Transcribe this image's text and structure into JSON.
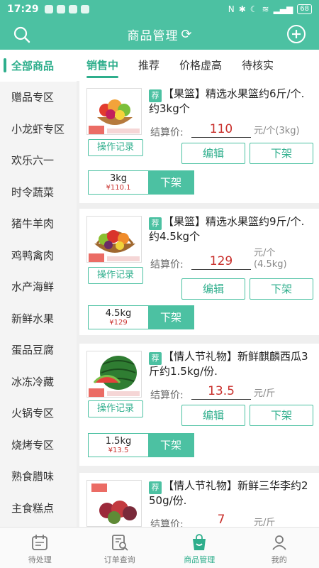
{
  "status_bar": {
    "time": "17:29",
    "battery": "68"
  },
  "header": {
    "title": "商品管理",
    "refresh_icon": "refresh-icon",
    "search_icon": "search-icon",
    "add_icon": "plus-circle-icon"
  },
  "sidebar": {
    "items": [
      {
        "label": "全部商品",
        "active": true
      },
      {
        "label": "赠品专区"
      },
      {
        "label": "小龙虾专区"
      },
      {
        "label": "欢乐六一"
      },
      {
        "label": "时令蔬菜"
      },
      {
        "label": "猪牛羊肉"
      },
      {
        "label": "鸡鸭禽肉"
      },
      {
        "label": "水产海鲜"
      },
      {
        "label": "新鲜水果"
      },
      {
        "label": "蛋品豆腐"
      },
      {
        "label": "冰冻冷藏"
      },
      {
        "label": "火锅专区"
      },
      {
        "label": "烧烤专区"
      },
      {
        "label": "熟食腊味"
      },
      {
        "label": "主食糕点"
      }
    ]
  },
  "tabs": [
    {
      "label": "销售中",
      "active": true
    },
    {
      "label": "推荐"
    },
    {
      "label": "价格虚高"
    },
    {
      "label": "待核实"
    }
  ],
  "products": [
    {
      "badge": "荐",
      "name": "【果篮】精选水果篮约6斤/个.约3kg个",
      "price_label": "结算价:",
      "price": "110",
      "unit": "元/个(3kg)",
      "op_label": "操作记录",
      "edit_label": "编辑",
      "off_label": "下架",
      "spec": {
        "weight": "3kg",
        "price": "¥110.1",
        "off_label": "下架"
      }
    },
    {
      "badge": "荐",
      "name": "【果篮】精选水果篮约9斤/个.约4.5kg个",
      "price_label": "结算价:",
      "price": "129",
      "unit": "元/个\n(4.5kg)",
      "op_label": "操作记录",
      "edit_label": "编辑",
      "off_label": "下架",
      "spec": {
        "weight": "4.5kg",
        "price": "¥129",
        "off_label": "下架"
      }
    },
    {
      "badge": "荐",
      "name": "【情人节礼物】新鲜麒麟西瓜3斤约1.5kg/份.",
      "price_label": "结算价:",
      "price": "13.5",
      "unit": "元/斤",
      "op_label": "操作记录",
      "edit_label": "编辑",
      "off_label": "下架",
      "spec": {
        "weight": "1.5kg",
        "price": "¥13.5",
        "off_label": "下架"
      }
    },
    {
      "badge": "荐",
      "name": "【情人节礼物】新鲜三华李约250g/份.",
      "price_label": "结算价:",
      "price": "7",
      "unit": "元/斤"
    }
  ],
  "bottom_nav": [
    {
      "label": "待处理",
      "icon": "calendar-icon"
    },
    {
      "label": "订单查询",
      "icon": "order-search-icon"
    },
    {
      "label": "商品管理",
      "icon": "shopping-bag-icon",
      "active": true
    },
    {
      "label": "我的",
      "icon": "person-icon"
    }
  ],
  "colors": {
    "primary": "#4cc1a2",
    "accent": "#2eae8c",
    "price": "#c9302c"
  }
}
